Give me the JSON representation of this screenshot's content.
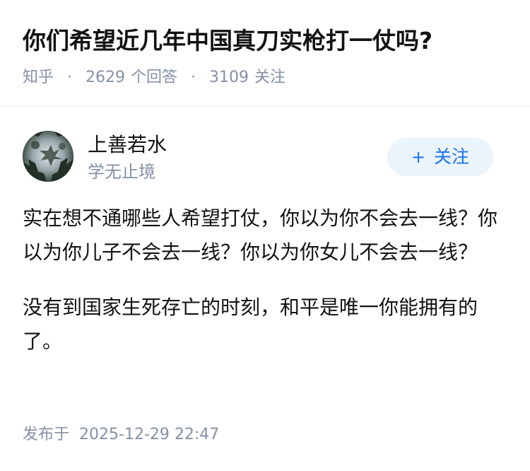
{
  "question": {
    "title": "你们希望近几年中国真刀实枪打一仗吗?",
    "meta": {
      "source": "知乎",
      "separator": "·",
      "answers_count": "2629",
      "answers_label": "个回答",
      "followers_count": "3109",
      "followers_label": "关注"
    }
  },
  "author": {
    "name": "上善若水",
    "bio": "学无止境",
    "follow_icon": "+",
    "follow_label": "关注"
  },
  "answer": {
    "paragraphs": [
      "实在想不通哪些人希望打仗，你以为你不会去一线？你以为你儿子不会去一线？你以为你女儿不会去一线？",
      "没有到国家生死存亡的时刻，和平是唯一你能拥有的了。"
    ],
    "published_label": "发布于",
    "published_time": "2025-12-29 22:47"
  },
  "colors": {
    "text": "#121212",
    "meta": "#8590a6",
    "accent": "#1772f6",
    "follow_bg": "#ebf3fb"
  }
}
